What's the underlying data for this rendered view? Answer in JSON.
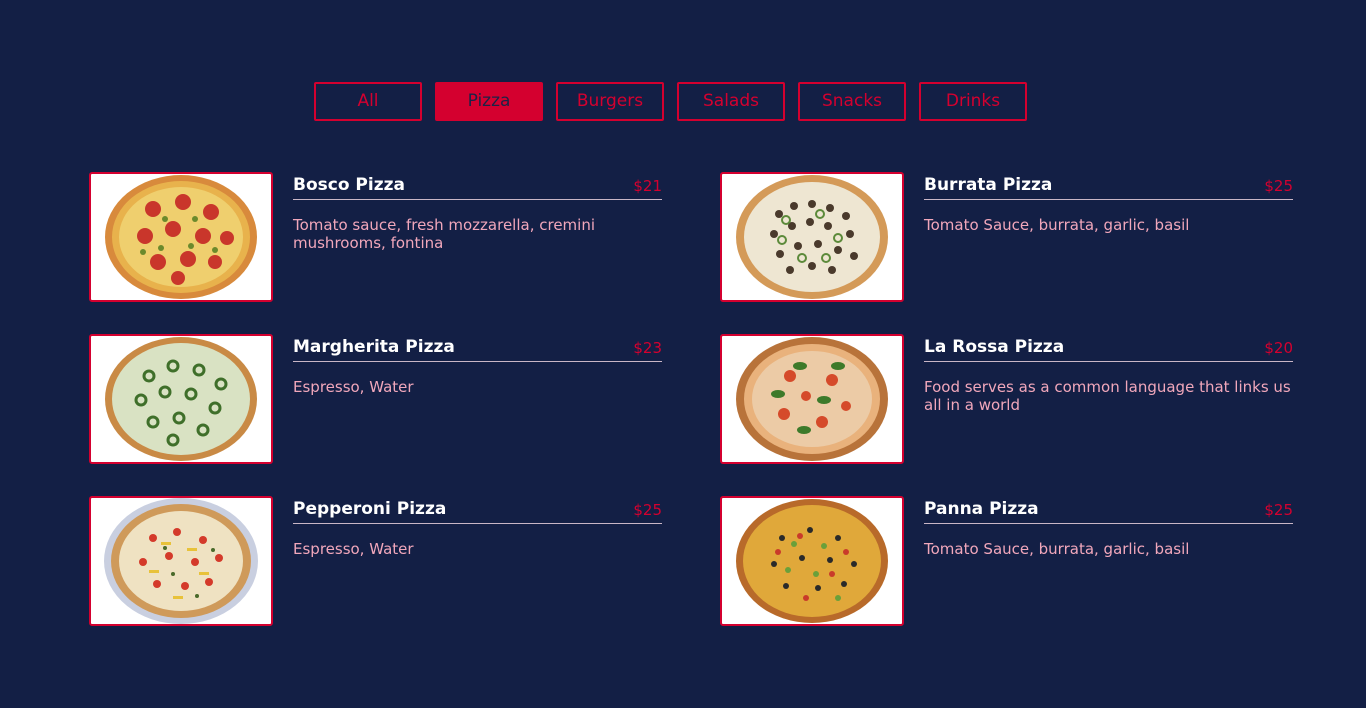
{
  "tabs": [
    {
      "label": "All"
    },
    {
      "label": "Pizza"
    },
    {
      "label": "Burgers"
    },
    {
      "label": "Salads"
    },
    {
      "label": "Snacks"
    },
    {
      "label": "Drinks"
    }
  ],
  "active_tab": "Pizza",
  "items": [
    {
      "name": "Bosco Pizza",
      "price": "$21",
      "description": "Tomato sauce, fresh mozzarella, cremini mushrooms, fontina"
    },
    {
      "name": "Burrata Pizza",
      "price": "$25",
      "description": "Tomato Sauce, burrata, garlic, basil"
    },
    {
      "name": "Margherita Pizza",
      "price": "$23",
      "description": "Espresso, Water"
    },
    {
      "name": "La Rossa Pizza",
      "price": "$20",
      "description": "Food serves as a common language that links us all in a world"
    },
    {
      "name": "Pepperoni Pizza",
      "price": "$25",
      "description": "Espresso, Water"
    },
    {
      "name": "Panna Pizza",
      "price": "$25",
      "description": "Tomato Sauce, burrata, garlic, basil"
    }
  ],
  "colors": {
    "background": "#131f45",
    "accent": "#d4002f",
    "description": "#f1a7bb"
  }
}
